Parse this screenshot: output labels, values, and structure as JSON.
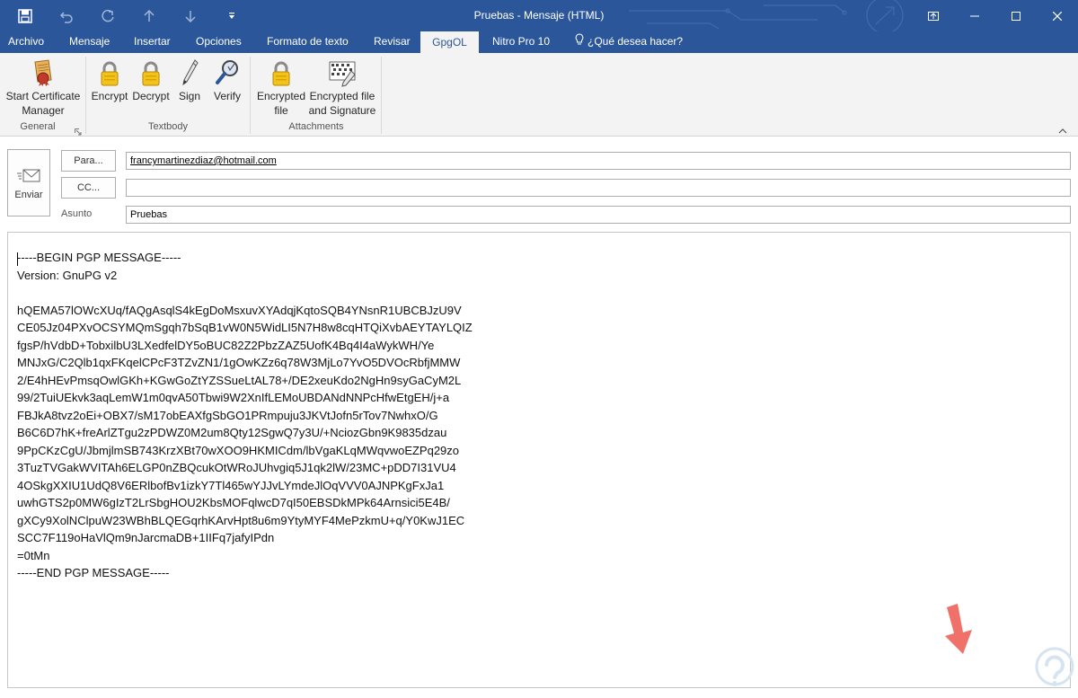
{
  "window": {
    "title": "Pruebas - Mensaje (HTML)"
  },
  "tabs": [
    {
      "label": "Archivo"
    },
    {
      "label": "Mensaje"
    },
    {
      "label": "Insertar"
    },
    {
      "label": "Opciones"
    },
    {
      "label": "Formato de texto"
    },
    {
      "label": "Revisar"
    },
    {
      "label": "GpgOL",
      "active": true
    },
    {
      "label": "Nitro Pro 10"
    },
    {
      "label": "¿Qué desea hacer?",
      "icon": "lightbulb-icon"
    }
  ],
  "ribbon": {
    "general": {
      "label": "General",
      "start_cert_line1": "Start Certificate",
      "start_cert_line2": "Manager"
    },
    "textbody": {
      "label": "Textbody",
      "encrypt": "Encrypt",
      "decrypt": "Decrypt",
      "sign": "Sign",
      "verify": "Verify"
    },
    "attachments": {
      "label": "Attachments",
      "enc_file_line1": "Encrypted",
      "enc_file_line2": "file",
      "enc_sig_line1": "Encrypted file",
      "enc_sig_line2": "and Signature"
    }
  },
  "compose": {
    "send_label": "Enviar",
    "to_button": "Para...",
    "cc_button": "CC...",
    "subject_label": "Asunto",
    "to_value": "francymartinezdiaz@hotmail.com",
    "cc_value": "",
    "subject_value": "Pruebas",
    "body_text": "-----BEGIN PGP MESSAGE-----\nVersion: GnuPG v2\n\nhQEMA57lOWcXUq/fAQgAsqlS4kEgDoMsxuvXYAdqjKqtoSQB4YNsnR1UBCBJzU9V\nCE05Jz04PXvOCSYMQmSgqh7bSqB1vW0N5WidLI5N7H8w8cqHTQiXvbAEYTAYLQIZ\nfgsP/hVdbD+TobxilbU3LXedfelDY5oBUC82Z2PbzZAZ5UofK4Bq4I4aWykWH/Ye\nMNJxG/C2Qlb1qxFKqelCPcF3TZvZN1/1gOwKZz6q78W3MjLo7YvO5DVOcRbfjMMW\n2/E4hHEvPmsqOwlGKh+KGwGoZtYZSSueLtAL78+/DE2xeuKdo2NgHn9syGaCyM2L\n99/2TuiUEkvk3aqLemW1m0qvA50Tbwi9W2XnIfLEMoUBDANdNNPcHfwEtgEH/j+a\nFBJkA8tvz2oEi+OBX7/sM17obEAXfgSbGO1PRmpuju3JKVtJofn5rTov7NwhxO/G\nB6C6D7hK+freArlZTgu2zPDWZ0M2um8Qty12SgwQ7y3U/+NciozGbn9K9835dzau\n9PpCKzCgU/JbmjlmSB743KrzXBt70wXOO9HKMICdm/lbVgaKLqMWqvwoEZPq29zo\n3TuzTVGakWVITAh6ELGP0nZBQcukOtWRoJUhvgiq5J1qk2lW/23MC+pDD7I31VU4\n4OSkgXXIU1UdQ8V6ERlbofBv1izkY7Tl465wYJJvLYmdeJlOqVVV0AJNPKgFxJa1\nuwhGTS2p0MW6gIzT2LrSbgHOU2KbsMOFqlwcD7qI50EBSDkMPk64Arnsici5E4B/\ngXCy9XolNClpuW23WBhBLQEGqrhKArvHpt8u6m9YtyMYF4MePzkmU+q/Y0KwJ1EC\nSCC7F119oHaVlQm9nJarcmaDB+1IIFq7jafyIPdn\n=0tMn\n-----END PGP MESSAGE-----"
  },
  "colors": {
    "accent": "#2b579a",
    "ribbon_bg": "#f3f3f3",
    "arrow": "#f0706a"
  }
}
